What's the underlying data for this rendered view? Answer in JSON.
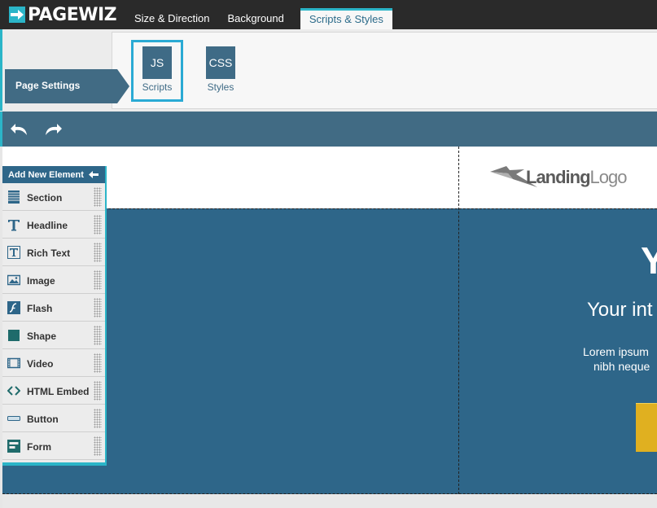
{
  "brand": {
    "name": "PAGEWIZ"
  },
  "tabs": [
    {
      "label": "Size & Direction"
    },
    {
      "label": "Background"
    },
    {
      "label": "Scripts & Styles"
    }
  ],
  "ribbon": {
    "page_settings_label": "Page Settings",
    "tools": [
      {
        "box": "JS",
        "label": "Scripts"
      },
      {
        "box": "CSS",
        "label": "Styles"
      }
    ]
  },
  "canvas": {
    "logo": {
      "bold": "Landing",
      "light": "Logo"
    },
    "hero_title": "Y",
    "hero_subtitle": "Your int",
    "hero_body": [
      "Lorem ipsum",
      "nibh neque"
    ]
  },
  "add_panel": {
    "title": "Add New Element",
    "items": [
      {
        "label": "Section",
        "icon": "section-icon"
      },
      {
        "label": "Headline",
        "icon": "headline-icon"
      },
      {
        "label": "Rich Text",
        "icon": "rich-text-icon"
      },
      {
        "label": "Image",
        "icon": "image-icon"
      },
      {
        "label": "Flash",
        "icon": "flash-icon"
      },
      {
        "label": "Shape",
        "icon": "shape-icon"
      },
      {
        "label": "Video",
        "icon": "video-icon"
      },
      {
        "label": "HTML Embed",
        "icon": "html-embed-icon"
      },
      {
        "label": "Button",
        "icon": "button-icon"
      },
      {
        "label": "Form",
        "icon": "form-icon"
      }
    ]
  },
  "colors": {
    "accent": "#2bb5c8",
    "primary": "#2e6689",
    "toolbar": "#416b84",
    "topbar": "#2a2a2a",
    "cta": "#e0b020"
  }
}
